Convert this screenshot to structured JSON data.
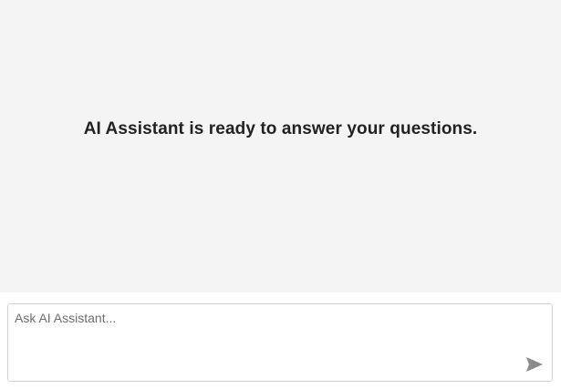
{
  "welcome": {
    "message": "AI Assistant is ready to answer your questions."
  },
  "composer": {
    "placeholder": "Ask AI Assistant...",
    "value": "",
    "send_icon": "send-icon"
  },
  "colors": {
    "messages_background": "#f4f4f4",
    "send_icon": "#8a8a8a"
  }
}
